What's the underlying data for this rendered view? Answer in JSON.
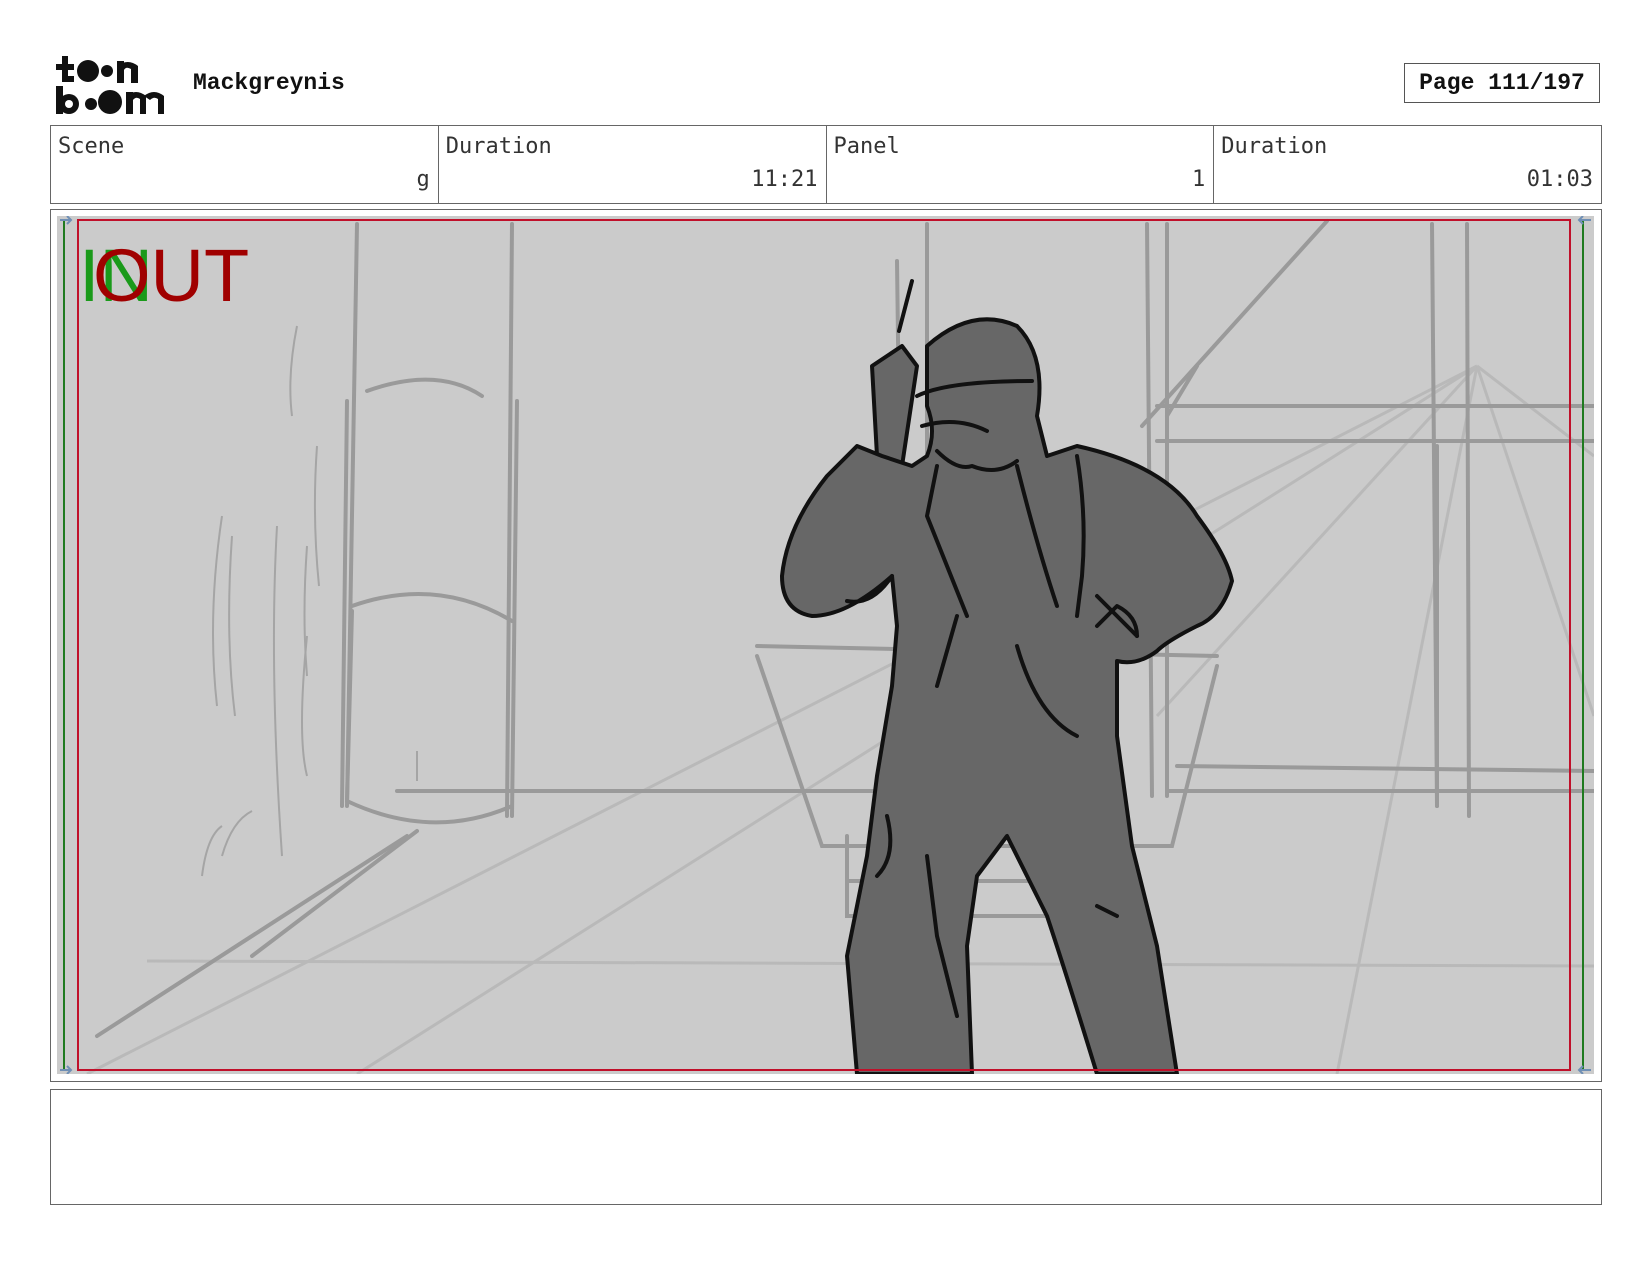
{
  "header": {
    "logo_text_line1": "toon",
    "logo_text_line2": "boom",
    "project_title": "Mackgreynis",
    "page_label": "Page 111/197"
  },
  "info": {
    "scene_label": "Scene",
    "scene_value": "g",
    "scene_duration_label": "Duration",
    "scene_duration_value": "11:21",
    "panel_label": "Panel",
    "panel_value": "1",
    "panel_duration_label": "Duration",
    "panel_duration_value": "01:03"
  },
  "panel": {
    "in_marker": "IN",
    "out_marker": "OUT",
    "colors": {
      "background": "#cbcbcb",
      "figure_fill": "#676767",
      "safe_frame_red": "#c0102a",
      "safe_frame_green": "#1f7a1f"
    }
  },
  "notes": {
    "text": ""
  }
}
